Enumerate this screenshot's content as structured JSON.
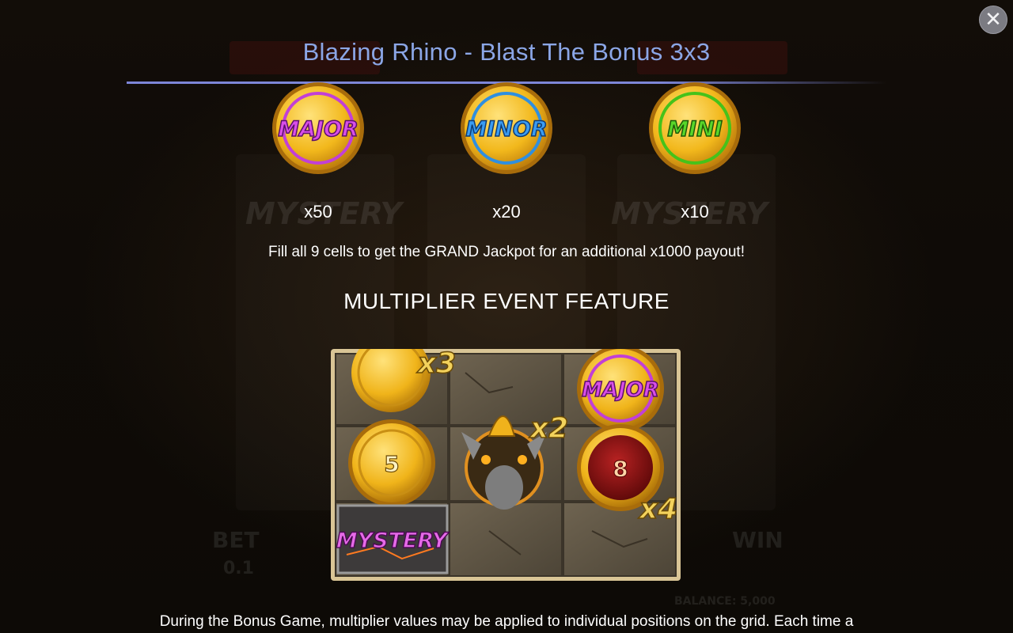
{
  "modal": {
    "title": "Blazing Rhino - Blast The Bonus 3x3",
    "close_icon": "close-icon"
  },
  "jackpots": [
    {
      "name": "MAJOR",
      "multiplier": "x50",
      "color": "#c23fd6"
    },
    {
      "name": "MINOR",
      "multiplier": "x20",
      "color": "#2f8fe0"
    },
    {
      "name": "MINI",
      "multiplier": "x10",
      "color": "#46c21a"
    }
  ],
  "grand_text": "Fill all 9 cells to get the GRAND Jackpot for an additional x1000 payout!",
  "feature": {
    "heading": "MULTIPLIER EVENT FEATURE",
    "grid": {
      "cells": [
        {
          "type": "coin",
          "value": "",
          "multiplier": "x3"
        },
        {
          "type": "empty"
        },
        {
          "type": "jackpot",
          "label": "MAJOR"
        },
        {
          "type": "coin",
          "value": "5"
        },
        {
          "type": "rhino",
          "multiplier": "x2"
        },
        {
          "type": "red-coin",
          "value": "8",
          "multiplier": "x4"
        },
        {
          "type": "mystery",
          "label": "MYSTERY"
        },
        {
          "type": "empty"
        },
        {
          "type": "empty"
        }
      ]
    }
  },
  "description": "During the Bonus Game, multiplier values may be applied to individual positions on the grid. Each time a",
  "background": {
    "bet_label": "BET",
    "bet_value": "0.1",
    "win_label": "WIN",
    "balance": "BALANCE: 5,000",
    "reel_label": "MYSTERY"
  }
}
